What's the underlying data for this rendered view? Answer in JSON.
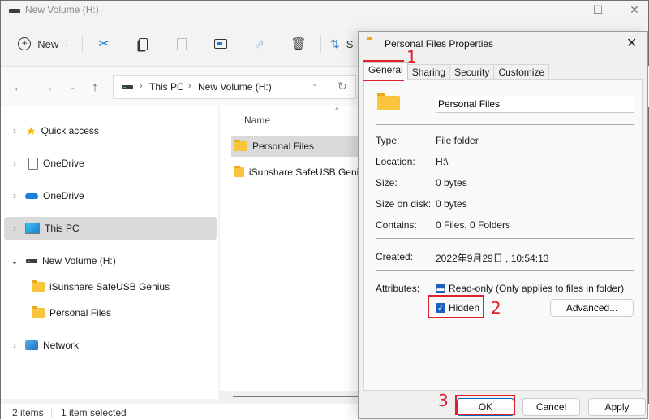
{
  "explorer": {
    "window_title": "New Volume (H:)",
    "window_controls": {
      "minimize": "—",
      "maximize": "☐",
      "close": "✕"
    },
    "toolbar": {
      "new_label": "New",
      "sort_label": "S",
      "icons": [
        "cut-icon",
        "copy-icon",
        "paste-icon",
        "rename-icon",
        "share-icon",
        "delete-icon",
        "sort-icon"
      ]
    },
    "address_bar": {
      "breadcrumbs": [
        "This PC",
        "New Volume (H:)"
      ],
      "separator": "›"
    },
    "sidebar": {
      "items": [
        {
          "label": "Quick access",
          "icon": "star-icon",
          "expander": "›"
        },
        {
          "label": "OneDrive",
          "icon": "document-icon",
          "expander": "›"
        },
        {
          "label": "OneDrive",
          "icon": "cloud-icon",
          "expander": "›"
        },
        {
          "label": "This PC",
          "icon": "monitor-icon",
          "expander": "›",
          "selected": true
        },
        {
          "label": "New Volume (H:)",
          "icon": "drive-icon",
          "expander": "⌄"
        },
        {
          "label": "iSunshare SafeUSB Genius",
          "icon": "folder-icon"
        },
        {
          "label": "Personal Files",
          "icon": "folder-icon"
        },
        {
          "label": "Network",
          "icon": "network-icon",
          "expander": "›"
        }
      ]
    },
    "file_list": {
      "column_header": "Name",
      "sort_indicator": "^",
      "rows": [
        {
          "name": "Personal Files",
          "selected": true
        },
        {
          "name": "iSunshare SafeUSB Genius",
          "selected": false
        }
      ]
    },
    "status": {
      "item_count": "2 items",
      "selection": "1 item selected"
    }
  },
  "dialog": {
    "title": "Personal Files Properties",
    "close": "✕",
    "tabs": [
      "General",
      "Sharing",
      "Security",
      "Customize"
    ],
    "active_tab": "General",
    "name_field_value": "Personal Files",
    "properties": [
      {
        "label": "Type:",
        "value": "File folder"
      },
      {
        "label": "Location:",
        "value": "H:\\"
      },
      {
        "label": "Size:",
        "value": "0 bytes"
      },
      {
        "label": "Size on disk:",
        "value": "0 bytes"
      },
      {
        "label": "Contains:",
        "value": "0 Files, 0 Folders"
      }
    ],
    "created": {
      "label": "Created:",
      "value": "2022年9月29日 , 10:54:13"
    },
    "attributes": {
      "label": "Attributes:",
      "readonly": {
        "label": "Read-only (Only applies to files in folder)",
        "state": "indeterminate"
      },
      "hidden": {
        "label": "Hidden",
        "state": "checked"
      },
      "advanced_button": "Advanced..."
    },
    "buttons": {
      "ok": "OK",
      "cancel": "Cancel",
      "apply": "Apply"
    }
  },
  "annotations": {
    "step1": "1",
    "step2": "2",
    "step3": "3",
    "color": "#e0212c"
  }
}
